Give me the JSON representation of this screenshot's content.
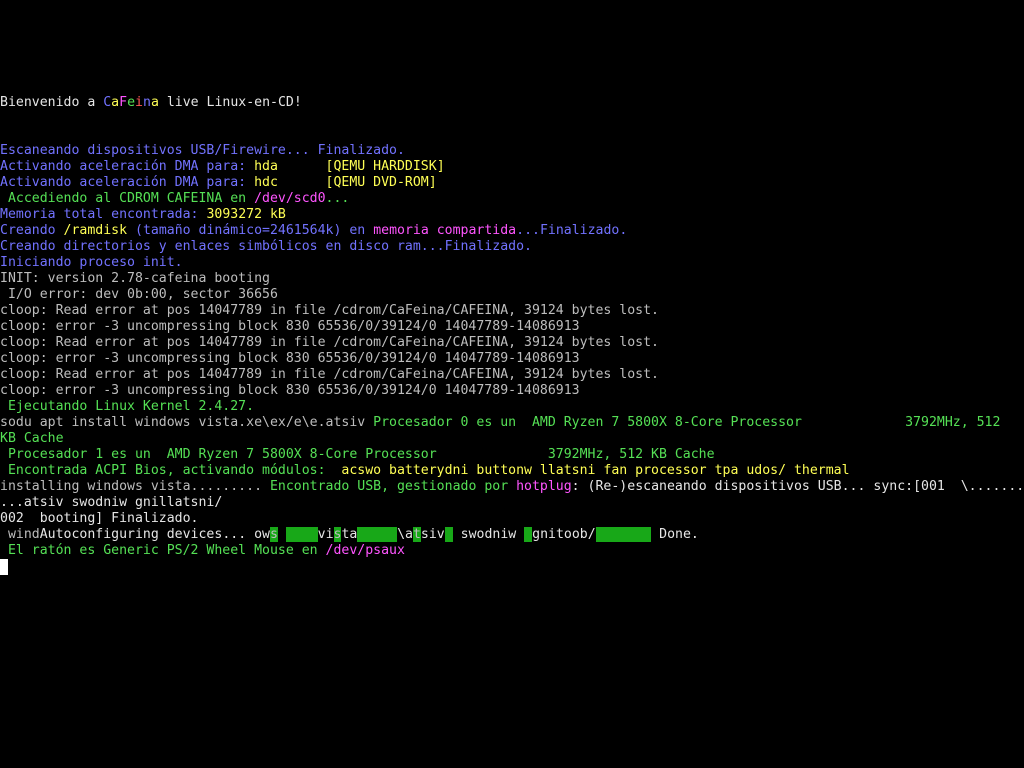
{
  "lines": [
    {
      "segs": [
        {
          "t": "Bienvenido a ",
          "c": "c-w"
        },
        {
          "t": "C",
          "c": "c-b"
        },
        {
          "t": "a",
          "c": "c-y"
        },
        {
          "t": "F",
          "c": "c-m"
        },
        {
          "t": "e",
          "c": "c-gr"
        },
        {
          "t": "i",
          "c": "c-r"
        },
        {
          "t": "n",
          "c": "c-b"
        },
        {
          "t": "a",
          "c": "c-y"
        },
        {
          "t": " live Linux-en-CD!",
          "c": "c-w"
        }
      ]
    },
    {
      "segs": []
    },
    {
      "segs": []
    },
    {
      "segs": [
        {
          "t": "Escaneando dispositivos USB/Firewire... Finalizado.",
          "c": "c-b"
        }
      ]
    },
    {
      "segs": [
        {
          "t": "Activando aceleración DMA para: ",
          "c": "c-b"
        },
        {
          "t": "hda      [QEMU HARDDISK]",
          "c": "c-y"
        }
      ]
    },
    {
      "segs": [
        {
          "t": "Activando aceleración DMA para: ",
          "c": "c-b"
        },
        {
          "t": "hdc      [QEMU DVD-ROM]",
          "c": "c-y"
        }
      ]
    },
    {
      "segs": [
        {
          "t": " Accediendo al CDROM CAFEINA en ",
          "c": "c-gr"
        },
        {
          "t": "/dev/scd0",
          "c": "c-m"
        },
        {
          "t": "...",
          "c": "c-gr"
        }
      ]
    },
    {
      "segs": [
        {
          "t": "Memoria total encontrada: ",
          "c": "c-b"
        },
        {
          "t": "3093272 kB",
          "c": "c-y"
        }
      ]
    },
    {
      "segs": [
        {
          "t": "Creando ",
          "c": "c-b"
        },
        {
          "t": "/ramdisk",
          "c": "c-y"
        },
        {
          "t": " (tamaño dinámico=2461564k) en ",
          "c": "c-b"
        },
        {
          "t": "memoria compartida",
          "c": "c-m"
        },
        {
          "t": "...Finalizado.",
          "c": "c-b"
        }
      ]
    },
    {
      "segs": [
        {
          "t": "Creando directorios y enlaces simbólicos en disco ram...Finalizado.",
          "c": "c-b"
        }
      ]
    },
    {
      "segs": [
        {
          "t": "Iniciando proceso init.",
          "c": "c-b"
        }
      ]
    },
    {
      "segs": [
        {
          "t": "INIT: version 2.78-cafeina booting",
          "c": "c-g"
        }
      ]
    },
    {
      "segs": [
        {
          "t": " I/O error: dev 0b:00, sector 36656",
          "c": "c-g"
        }
      ]
    },
    {
      "segs": [
        {
          "t": "cloop: Read error at pos 14047789 in file /cdrom/CaFeina/CAFEINA, 39124 bytes lost.",
          "c": "c-g"
        }
      ]
    },
    {
      "segs": [
        {
          "t": "cloop: error -3 uncompressing block 830 65536/0/39124/0 14047789-14086913",
          "c": "c-g"
        }
      ]
    },
    {
      "segs": [
        {
          "t": "cloop: Read error at pos 14047789 in file /cdrom/CaFeina/CAFEINA, 39124 bytes lost.",
          "c": "c-g"
        }
      ]
    },
    {
      "segs": [
        {
          "t": "cloop: error -3 uncompressing block 830 65536/0/39124/0 14047789-14086913",
          "c": "c-g"
        }
      ]
    },
    {
      "segs": [
        {
          "t": "cloop: Read error at pos 14047789 in file /cdrom/CaFeina/CAFEINA, 39124 bytes lost.",
          "c": "c-g"
        }
      ]
    },
    {
      "segs": [
        {
          "t": "cloop: error -3 uncompressing block 830 65536/0/39124/0 14047789-14086913",
          "c": "c-g"
        }
      ]
    },
    {
      "segs": [
        {
          "t": " Ejecutando Linux Kernel 2.4.27.",
          "c": "c-gr"
        }
      ]
    },
    {
      "segs": [
        {
          "t": "sodu apt install windows vista.xe\\ex/e\\e.atsiv ",
          "c": "c-g"
        },
        {
          "t": "Procesador 0 es un  AMD Ryzen 7 5800X 8-Core Processor             3792MHz, 512",
          "c": "c-gr"
        }
      ]
    },
    {
      "segs": [
        {
          "t": "KB Cache",
          "c": "c-gr"
        }
      ]
    },
    {
      "segs": [
        {
          "t": " Procesador 1 es un  AMD Ryzen 7 5800X 8-Core Processor              3792MHz, 512 KB Cache",
          "c": "c-gr"
        }
      ]
    },
    {
      "segs": [
        {
          "t": " Encontrada ACPI Bios, activando módulos:  ",
          "c": "c-gr"
        },
        {
          "t": "acswo batterydni buttonw llatsni fan processor tpa udos/ thermal",
          "c": "c-y"
        }
      ]
    },
    {
      "segs": [
        {
          "t": "installing windows vista......... ",
          "c": "c-g"
        },
        {
          "t": "Encontrado USB, gestionado por ",
          "c": "c-gr"
        },
        {
          "t": "hotplug",
          "c": "c-m"
        },
        {
          "t": ": (Re-)escaneando dispositivos USB... sync:[001  \\.......",
          "c": "c-w"
        }
      ]
    },
    {
      "segs": [
        {
          "t": "...atsiv swodniw gnillatsni/",
          "c": "c-w"
        }
      ]
    },
    {
      "segs": [
        {
          "t": "002  booting] Finalizado.",
          "c": "c-w"
        }
      ]
    },
    {
      "segs": [
        {
          "t": " wind",
          "c": "c-g"
        },
        {
          "t": "Autoconfiguring devices... ",
          "c": "c-w"
        },
        {
          "t": "ow",
          "c": "c-w"
        },
        {
          "t": "s",
          "c": "c-bk-sm"
        },
        {
          "t": " ",
          "c": "c-w"
        },
        {
          "t": "    ",
          "c": "c-bk-gr"
        },
        {
          "t": "vi",
          "c": "c-w"
        },
        {
          "t": "s",
          "c": "c-bk-sm"
        },
        {
          "t": "ta",
          "c": "c-w"
        },
        {
          "t": "     ",
          "c": "c-bk-gr"
        },
        {
          "t": "\\a",
          "c": "c-w"
        },
        {
          "t": "t",
          "c": "c-bk-sm"
        },
        {
          "t": "siv",
          "c": "c-w"
        },
        {
          "t": " ",
          "c": "c-bk-gr"
        },
        {
          "t": " swodniw ",
          "c": "c-w"
        },
        {
          "t": " ",
          "c": "c-bk-gr"
        },
        {
          "t": "gnitoob/",
          "c": "c-w"
        },
        {
          "t": "       ",
          "c": "c-bk-gr"
        },
        {
          "t": " Done.",
          "c": "c-w"
        }
      ]
    },
    {
      "segs": [
        {
          "t": " El ratón es Generic PS/2 Wheel Mouse en ",
          "c": "c-gr"
        },
        {
          "t": "/dev/psaux",
          "c": "c-m"
        }
      ]
    }
  ]
}
